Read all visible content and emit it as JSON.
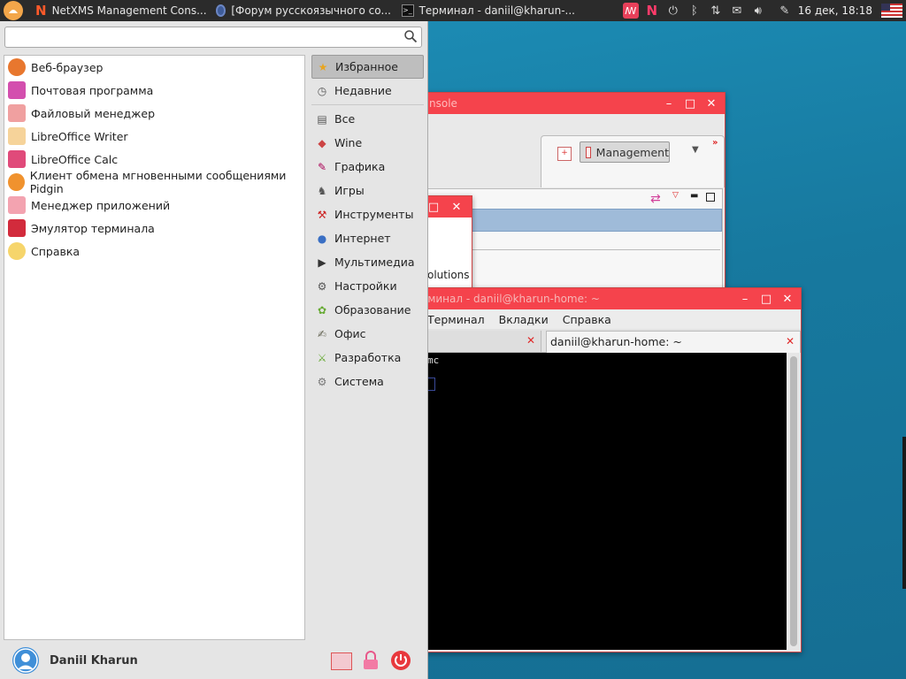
{
  "taskbar": {
    "tasks": [
      {
        "label": "NetXMS Management Cons...",
        "icon": "netxms-icon"
      },
      {
        "label": "[Форум русскоязычного со...",
        "icon": "browser-icon"
      },
      {
        "label": "Терминал - daniil@kharun-...",
        "icon": "terminal-icon"
      }
    ],
    "clock": "16 дек, 18:18"
  },
  "menu": {
    "search": {
      "value": "",
      "placeholder": ""
    },
    "apps": [
      {
        "label": "Веб-браузер",
        "icon": "web-browser-icon",
        "color": "#e8772e"
      },
      {
        "label": "Почтовая программа",
        "icon": "mail-icon",
        "color": "#d34fae"
      },
      {
        "label": "Файловый менеджер",
        "icon": "folder-icon",
        "color": "#f0a0a0"
      },
      {
        "label": "LibreOffice Writer",
        "icon": "writer-icon",
        "color": "#f6d39a"
      },
      {
        "label": "LibreOffice Calc",
        "icon": "calc-icon",
        "color": "#e04a7a"
      },
      {
        "label": "Клиент обмена мгновенными сообщениями Pidgin",
        "icon": "pidgin-icon",
        "color": "#f0922e"
      },
      {
        "label": "Менеджер приложений",
        "icon": "app-manager-icon",
        "color": "#f3a3b0"
      },
      {
        "label": "Эмулятор терминала",
        "icon": "terminal-emulator-icon",
        "color": "#d22b3c"
      },
      {
        "label": "Справка",
        "icon": "help-icon",
        "color": "#f6d56b"
      }
    ],
    "categories_top": [
      {
        "label": "Избранное",
        "icon": "star-icon",
        "selected": true
      },
      {
        "label": "Недавние",
        "icon": "clock-icon",
        "selected": false
      }
    ],
    "categories": [
      {
        "label": "Все",
        "icon": "all-icon"
      },
      {
        "label": "Wine",
        "icon": "wine-icon"
      },
      {
        "label": "Графика",
        "icon": "graphics-icon"
      },
      {
        "label": "Игры",
        "icon": "games-icon"
      },
      {
        "label": "Инструменты",
        "icon": "tools-icon"
      },
      {
        "label": "Интернет",
        "icon": "internet-icon"
      },
      {
        "label": "Мультимедиа",
        "icon": "multimedia-icon"
      },
      {
        "label": "Настройки",
        "icon": "settings-icon"
      },
      {
        "label": "Образование",
        "icon": "education-icon"
      },
      {
        "label": "Офис",
        "icon": "office-icon"
      },
      {
        "label": "Разработка",
        "icon": "development-icon"
      },
      {
        "label": "Система",
        "icon": "system-icon"
      }
    ],
    "user": "Daniil Kharun"
  },
  "netxms_window": {
    "title_partial": "nsole",
    "perspective_label": "Management",
    "inner_text": "olutions"
  },
  "terminal_window": {
    "title": "Терминал - daniil@kharun-home: ~",
    "menubar": [
      "Терминал",
      "Вкладки",
      "Справка"
    ],
    "tab_label": "daniil@kharun-home: ~",
    "content_partial": "mc"
  },
  "colors": {
    "titlebar": "#f5434c",
    "panel": "#2b2b2b",
    "desktop": "#1a82aa"
  }
}
